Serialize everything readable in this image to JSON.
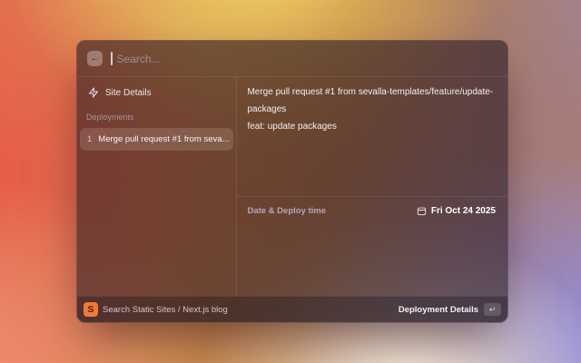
{
  "colors": {
    "logo_orange": "#ee7c36",
    "selection_highlight": "rgba(255,255,255,0.13)",
    "modal_tint": "rgba(33,23,36,0.58)"
  },
  "icons": {
    "back_glyph": "←",
    "enter_glyph": "↵",
    "site_icon": "zap-icon",
    "date_icon": "calendar-icon",
    "logo_icon": "sevalla-logo"
  },
  "search": {
    "placeholder": "Search..."
  },
  "sidebar": {
    "site_details_label": "Site Details",
    "section_label": "Deployments",
    "item": {
      "index": "1",
      "label": "Merge pull request #1 from seva..."
    }
  },
  "detail": {
    "title": "Merge pull request #1 from sevalla-templates/feature/update-packages",
    "message": "feat: update packages",
    "date_label": "Date & Deploy time",
    "date_value": "Fri Oct 24 2025"
  },
  "footer": {
    "logo_letter": "S",
    "context_label": "Search Static Sites / Next.js blog",
    "action_label": "Deployment Details"
  }
}
